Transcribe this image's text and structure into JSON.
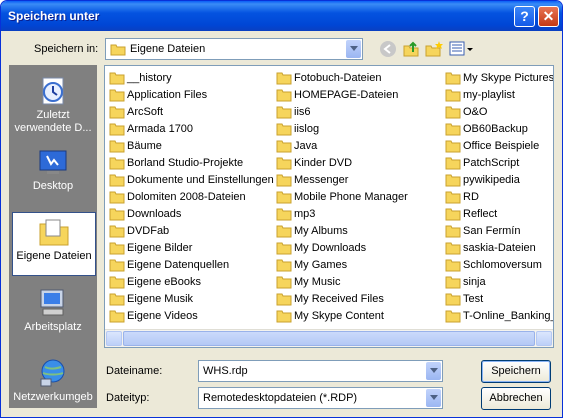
{
  "window": {
    "title": "Speichern unter"
  },
  "toolbar": {
    "save_in_label": "Speichern in:",
    "save_in_value": "Eigene Dateien"
  },
  "places": [
    {
      "label": "Zuletzt verwendete D..."
    },
    {
      "label": "Desktop"
    },
    {
      "label": "Eigene Dateien"
    },
    {
      "label": "Arbeitsplatz"
    },
    {
      "label": "Netzwerkumgeb"
    }
  ],
  "files": {
    "col1": [
      "__history",
      "Application Files",
      "ArcSoft",
      "Armada 1700",
      "Bäume",
      "Borland Studio-Projekte",
      "Dokumente und Einstellungen",
      "Dolomiten 2008-Dateien",
      "Downloads",
      "DVDFab",
      "Eigene Bilder",
      "Eigene Datenquellen",
      "Eigene eBooks",
      "Eigene Musik",
      "Eigene Videos"
    ],
    "col2": [
      "Fotobuch-Dateien",
      "HOMEPAGE-Dateien",
      "iis6",
      "iislog",
      "Java",
      "Kinder DVD",
      "Messenger",
      "Mobile Phone Manager",
      "mp3",
      "My Albums",
      "My Downloads",
      "My Games",
      "My Music",
      "My Received Files",
      "My Skype Content"
    ],
    "col3": [
      "My Skype Pictures",
      "my-playlist",
      "O&O",
      "OB60Backup",
      "Office Beispiele",
      "PatchScript",
      "pywikipedia",
      "RD",
      "Reflect",
      "San Fermín",
      "saskia-Dateien",
      "Schlomoversum",
      "sinja",
      "Test",
      "T-Online_Banking_I"
    ]
  },
  "form": {
    "filename_label": "Dateiname:",
    "filename_value": "WHS.rdp",
    "filetype_label": "Dateityp:",
    "filetype_value": "Remotedesktopdateien (*.RDP)"
  },
  "buttons": {
    "save": "Speichern",
    "cancel": "Abbrechen"
  },
  "colors": {
    "folder": "#f6d55c",
    "titlebar": "#0453e0",
    "places_bg": "#808080"
  }
}
